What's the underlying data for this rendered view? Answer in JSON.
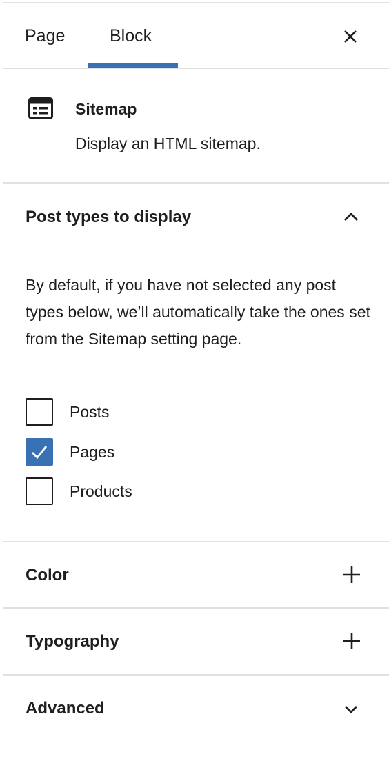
{
  "tabs": {
    "page_label": "Page",
    "block_label": "Block",
    "active": "Block"
  },
  "block": {
    "icon": "sitemap-block-icon",
    "title": "Sitemap",
    "description": "Display an HTML sitemap."
  },
  "post_types": {
    "title": "Post types to display",
    "expanded": true,
    "help": "By default, if you have not selected any post types below, we’ll automatically take the ones set from the Sitemap setting page.",
    "options": [
      {
        "label": "Posts",
        "checked": false
      },
      {
        "label": "Pages",
        "checked": true
      },
      {
        "label": "Products",
        "checked": false
      }
    ]
  },
  "sections": {
    "color": "Color",
    "typography": "Typography",
    "advanced": "Advanced"
  },
  "colors": {
    "accent": "#3872b5",
    "text": "#1e1e1e",
    "divider": "#e0e0e0"
  }
}
